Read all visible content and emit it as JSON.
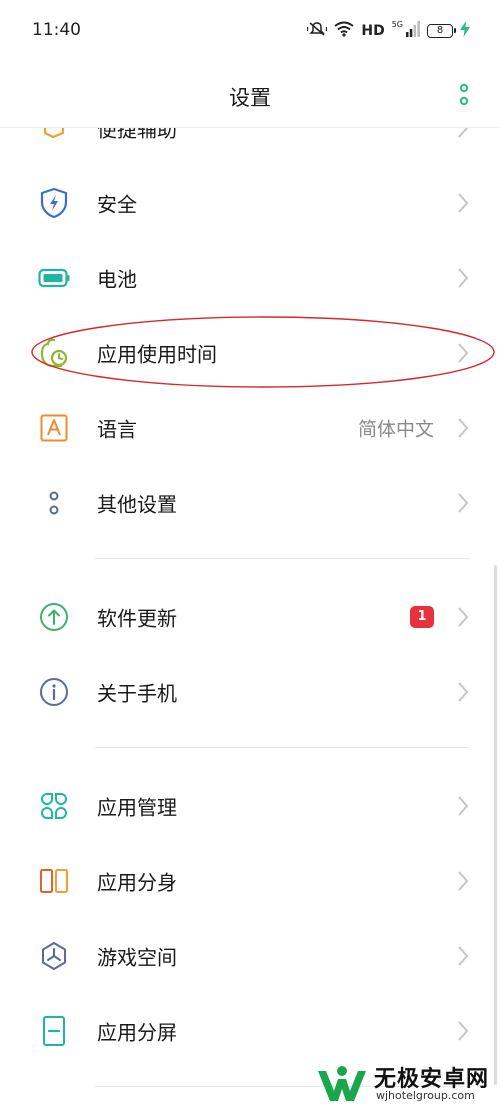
{
  "status_bar": {
    "time": "11:40",
    "hd_label": "HD",
    "signal_tag": "5G",
    "battery_level": "8",
    "icons": [
      "mute-vibrate-icon",
      "wifi-icon",
      "signal-icon",
      "battery-icon",
      "charging-icon"
    ]
  },
  "header": {
    "title": "设置",
    "more_icon": "more-vertical-icon",
    "accent_color": "#2bbf7f"
  },
  "settings": {
    "items": [
      {
        "label": "便捷辅助",
        "icon": "convenience-icon"
      },
      {
        "label": "安全",
        "icon": "shield-icon"
      },
      {
        "label": "电池",
        "icon": "battery-setting-icon"
      },
      {
        "label": "应用使用时间",
        "icon": "app-usage-time-icon",
        "highlighted": true
      },
      {
        "label": "语言",
        "icon": "language-icon",
        "value": "简体中文"
      },
      {
        "label": "其他设置",
        "icon": "other-settings-icon"
      },
      {
        "label": "软件更新",
        "icon": "software-update-icon",
        "badge": "1"
      },
      {
        "label": "关于手机",
        "icon": "about-phone-icon"
      },
      {
        "label": "应用管理",
        "icon": "app-management-icon"
      },
      {
        "label": "应用分身",
        "icon": "app-clone-icon"
      },
      {
        "label": "游戏空间",
        "icon": "game-space-icon"
      },
      {
        "label": "应用分屏",
        "icon": "split-screen-icon"
      }
    ]
  },
  "watermark": {
    "name": "无极安卓网",
    "url": "wjhotelgroup.com"
  },
  "colors": {
    "annotation_red": "#d9262b",
    "badge_red": "#e5323e",
    "chevron_gray": "#c4c4c4"
  }
}
